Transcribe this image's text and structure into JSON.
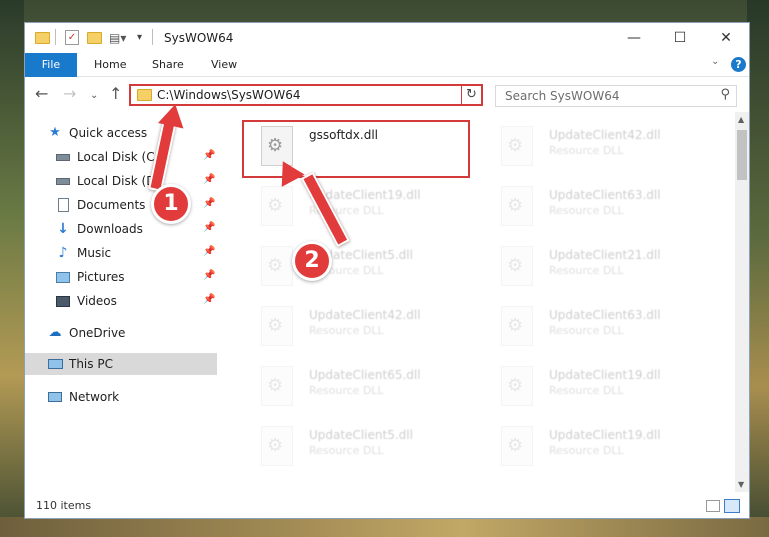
{
  "window": {
    "title": "SysWOW64",
    "minimize": "—",
    "maximize": "☐",
    "close": "✕"
  },
  "ribbon": {
    "file": "File",
    "home": "Home",
    "share": "Share",
    "view": "View",
    "help": "?"
  },
  "address_bar": {
    "path": "C:\\Windows\\SysWOW64"
  },
  "search": {
    "placeholder": "Search SysWOW64"
  },
  "sidebar": {
    "items": [
      {
        "label": "Quick access",
        "icon": "star-icon",
        "pinned": false
      },
      {
        "label": "Local Disk (C:)",
        "icon": "drive-icon",
        "pinned": true
      },
      {
        "label": "Local Disk (D:)",
        "icon": "drive-icon",
        "pinned": true
      },
      {
        "label": "Documents",
        "icon": "documents-icon",
        "pinned": true
      },
      {
        "label": "Downloads",
        "icon": "download-icon",
        "pinned": true
      },
      {
        "label": "Music",
        "icon": "music-icon",
        "pinned": true
      },
      {
        "label": "Pictures",
        "icon": "pictures-icon",
        "pinned": true
      },
      {
        "label": "Videos",
        "icon": "videos-icon",
        "pinned": true
      },
      {
        "label": "OneDrive",
        "icon": "cloud-icon",
        "pinned": false
      },
      {
        "label": "This PC",
        "icon": "computer-icon",
        "pinned": false
      },
      {
        "label": "Network",
        "icon": "network-icon",
        "pinned": false
      }
    ]
  },
  "files": [
    {
      "name": "gssoftdx.dll",
      "type": "",
      "highlighted": true
    },
    {
      "name": "UpdateClient42.dll",
      "type": "Resource DLL",
      "highlighted": false
    },
    {
      "name": "UpdateClient19.dll",
      "type": "Resource DLL",
      "highlighted": false
    },
    {
      "name": "UpdateClient63.dll",
      "type": "Resource DLL",
      "highlighted": false
    },
    {
      "name": "UpdateClient5.dll",
      "type": "Resource DLL",
      "highlighted": false
    },
    {
      "name": "UpdateClient21.dll",
      "type": "Resource DLL",
      "highlighted": false
    },
    {
      "name": "UpdateClient42.dll",
      "type": "Resource DLL",
      "highlighted": false
    },
    {
      "name": "UpdateClient63.dll",
      "type": "Resource DLL",
      "highlighted": false
    },
    {
      "name": "UpdateClient65.dll",
      "type": "Resource DLL",
      "highlighted": false
    },
    {
      "name": "UpdateClient19.dll",
      "type": "Resource DLL",
      "highlighted": false
    },
    {
      "name": "UpdateClient5.dll",
      "type": "Resource DLL",
      "highlighted": false
    },
    {
      "name": "UpdateClient19.dll",
      "type": "Resource DLL",
      "highlighted": false
    }
  ],
  "status": {
    "item_count": "110 items"
  },
  "callouts": {
    "step1": "1",
    "step2": "2"
  },
  "colors": {
    "accent": "#1979ca",
    "highlight_red": "#d33a3a",
    "callout_red": "#e23b3b"
  }
}
